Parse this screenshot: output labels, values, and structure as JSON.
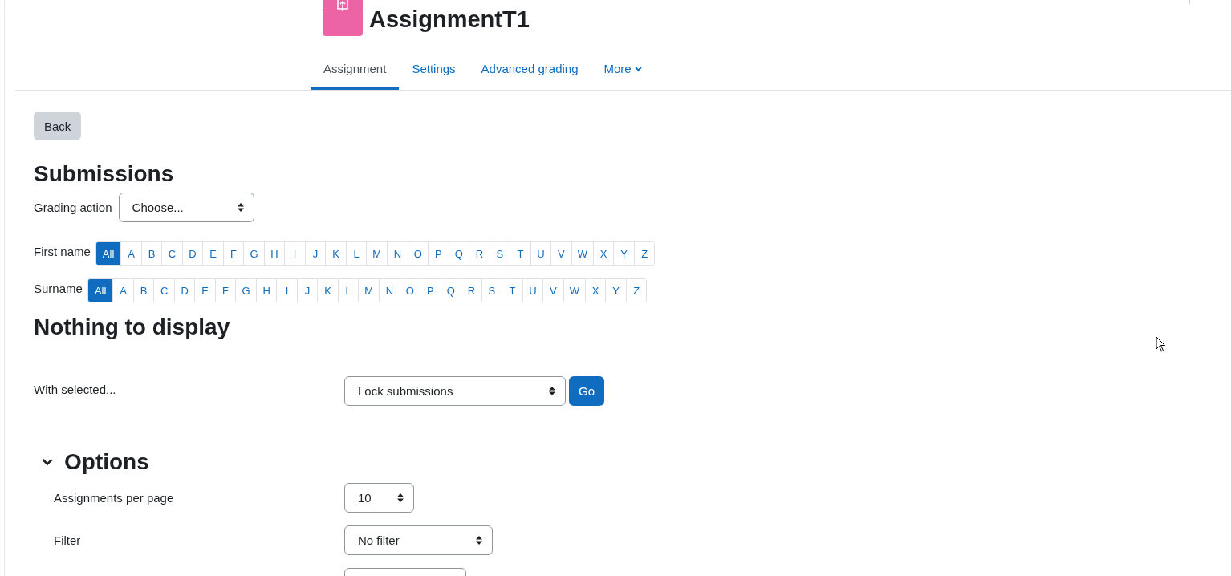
{
  "header": {
    "title": "AssignmentT1"
  },
  "tabs": [
    {
      "label": "Assignment",
      "selected": true
    },
    {
      "label": "Settings",
      "selected": false
    },
    {
      "label": "Advanced grading",
      "selected": false
    },
    {
      "label": "More",
      "selected": false,
      "kind": "dropdown"
    }
  ],
  "back_button": "Back",
  "heading": "Submissions",
  "grading_action": {
    "label": "Grading action",
    "value": "Choose..."
  },
  "initials_bars": [
    {
      "label": "First name",
      "letters": [
        {
          "label": "All",
          "selected": true
        },
        {
          "label": "A",
          "selected": false
        },
        {
          "label": "B",
          "selected": false
        },
        {
          "label": "C",
          "selected": false
        },
        {
          "label": "D",
          "selected": false
        },
        {
          "label": "E",
          "selected": false
        },
        {
          "label": "F",
          "selected": false
        },
        {
          "label": "G",
          "selected": false
        },
        {
          "label": "H",
          "selected": false
        },
        {
          "label": "I",
          "selected": false
        },
        {
          "label": "J",
          "selected": false
        },
        {
          "label": "K",
          "selected": false
        },
        {
          "label": "L",
          "selected": false
        },
        {
          "label": "M",
          "selected": false
        },
        {
          "label": "N",
          "selected": false
        },
        {
          "label": "O",
          "selected": false
        },
        {
          "label": "P",
          "selected": false
        },
        {
          "label": "Q",
          "selected": false
        },
        {
          "label": "R",
          "selected": false
        },
        {
          "label": "S",
          "selected": false
        },
        {
          "label": "T",
          "selected": false
        },
        {
          "label": "U",
          "selected": false
        },
        {
          "label": "V",
          "selected": false
        },
        {
          "label": "W",
          "selected": false
        },
        {
          "label": "X",
          "selected": false
        },
        {
          "label": "Y",
          "selected": false
        },
        {
          "label": "Z",
          "selected": false
        }
      ]
    },
    {
      "label": "Surname",
      "letters": [
        {
          "label": "All",
          "selected": true
        },
        {
          "label": "A",
          "selected": false
        },
        {
          "label": "B",
          "selected": false
        },
        {
          "label": "C",
          "selected": false
        },
        {
          "label": "D",
          "selected": false
        },
        {
          "label": "E",
          "selected": false
        },
        {
          "label": "F",
          "selected": false
        },
        {
          "label": "G",
          "selected": false
        },
        {
          "label": "H",
          "selected": false
        },
        {
          "label": "I",
          "selected": false
        },
        {
          "label": "J",
          "selected": false
        },
        {
          "label": "K",
          "selected": false
        },
        {
          "label": "L",
          "selected": false
        },
        {
          "label": "M",
          "selected": false
        },
        {
          "label": "N",
          "selected": false
        },
        {
          "label": "O",
          "selected": false
        },
        {
          "label": "P",
          "selected": false
        },
        {
          "label": "Q",
          "selected": false
        },
        {
          "label": "R",
          "selected": false
        },
        {
          "label": "S",
          "selected": false
        },
        {
          "label": "T",
          "selected": false
        },
        {
          "label": "U",
          "selected": false
        },
        {
          "label": "V",
          "selected": false
        },
        {
          "label": "W",
          "selected": false
        },
        {
          "label": "X",
          "selected": false
        },
        {
          "label": "Y",
          "selected": false
        },
        {
          "label": "Z",
          "selected": false
        }
      ]
    }
  ],
  "empty_message": "Nothing to display",
  "with_selected": {
    "label": "With selected...",
    "value": "Lock submissions",
    "button": "Go"
  },
  "options": {
    "title": "Options",
    "expanded": true,
    "fields": [
      {
        "label": "Assignments per page",
        "value": "10",
        "kind": "narrow"
      },
      {
        "label": "Filter",
        "value": "No filter",
        "kind": "medium"
      }
    ]
  }
}
